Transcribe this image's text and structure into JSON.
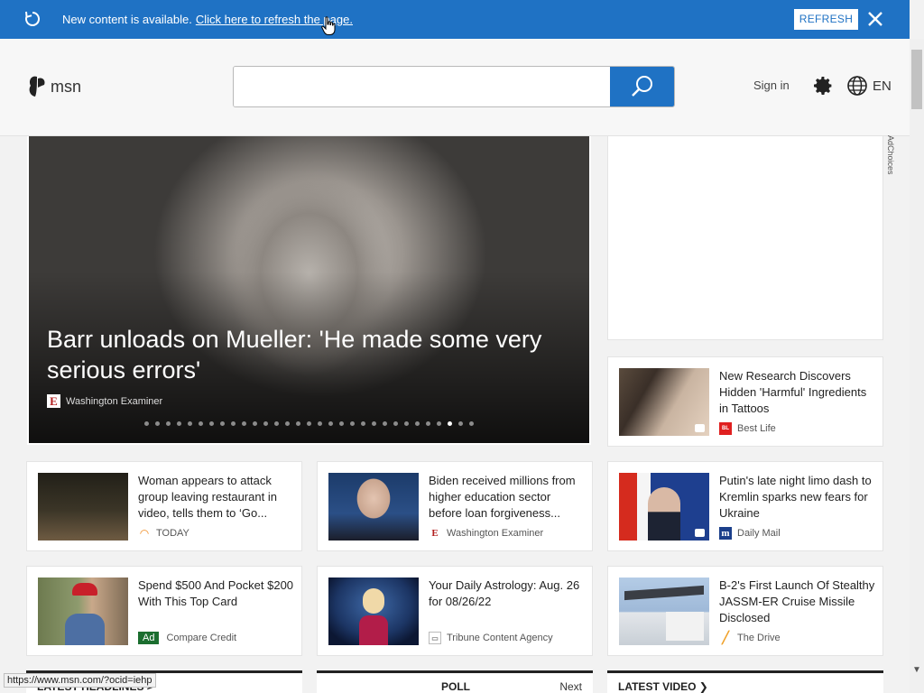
{
  "notification": {
    "message": "New content is available.",
    "link": "Click here to refresh the page.",
    "refresh_button": "REFRESH",
    "bar_color": "#1f72c4"
  },
  "header": {
    "logo_text": "msn",
    "search_placeholder": "",
    "signin": "Sign in",
    "language": "EN",
    "adchoices": "AdChoices"
  },
  "hero": {
    "headline": "Barr unloads on Mueller: 'He made some very serious errors'",
    "source": "Washington Examiner",
    "slide_count": 31,
    "active_slide": 28
  },
  "cards": [
    {
      "title": "New Research Discovers Hidden 'Harmful' Ingredients in Tattoos",
      "source": "Best Life",
      "icon": "best-life-icon"
    },
    {
      "title": "Woman appears to attack group leaving restaurant in video, tells them to ‘Go...",
      "source": "TODAY",
      "icon": "today-icon"
    },
    {
      "title": "Biden received millions from higher education sector before loan forgiveness...",
      "source": "Washington Examiner",
      "icon": "washington-examiner-icon"
    },
    {
      "title": "Putin's late night limo dash to Kremlin sparks new fears for Ukraine",
      "source": "Daily Mail",
      "icon": "daily-mail-icon"
    },
    {
      "title": "Spend $500 And Pocket $200 With This Top Card",
      "source": "Compare Credit",
      "ad_label": "Ad"
    },
    {
      "title": "Your Daily Astrology: Aug. 26 for 08/26/22",
      "source": "Tribune Content Agency",
      "icon": "tribune-icon"
    },
    {
      "title": "B-2's First Launch Of Stealthy JASSM-ER Cruise Missile Disclosed",
      "source": "The Drive",
      "icon": "the-drive-icon"
    }
  ],
  "sections": {
    "latest_headlines": "LATEST HEADLINES >",
    "poll": "POLL",
    "poll_next": "Next",
    "latest_video": "LATEST VIDEO"
  },
  "status_url": "https://www.msn.com/?ocid=iehp"
}
